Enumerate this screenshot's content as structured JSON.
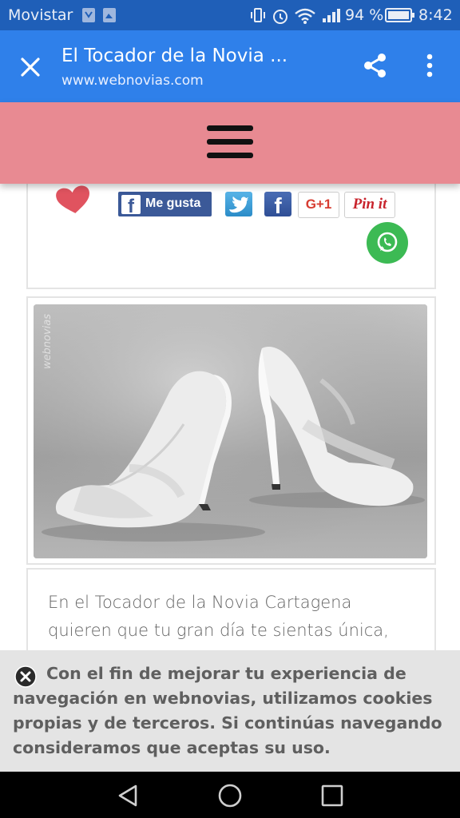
{
  "status_bar": {
    "carrier": "Movistar",
    "battery_percent": "94 %",
    "time": "8:42"
  },
  "toolbar": {
    "title": "El Tocador de la Novia ...",
    "url": "www.webnovias.com"
  },
  "social": {
    "like_label": "Me gusta",
    "google_label": "G+1",
    "pinterest_label": "Pin it"
  },
  "photo": {
    "watermark": "webnovias"
  },
  "article": {
    "lines": [
      "En el  Tocador de la Novia Cartagena",
      "quieren que  tu gran día te sientas única,"
    ]
  },
  "cookie": {
    "lines": [
      "Con el fin de mejorar tu experiencia de",
      "navegación en webnovias, utilizamos cookies",
      "propias y de terceros. Si continúas navegando",
      "consideramos que aceptas su uso."
    ]
  },
  "colors": {
    "status_bar": "#1f5fb8",
    "toolbar": "#2f80ea",
    "site_header": "#e88a92",
    "whatsapp": "#3cba54",
    "facebook": "#3b5998"
  }
}
